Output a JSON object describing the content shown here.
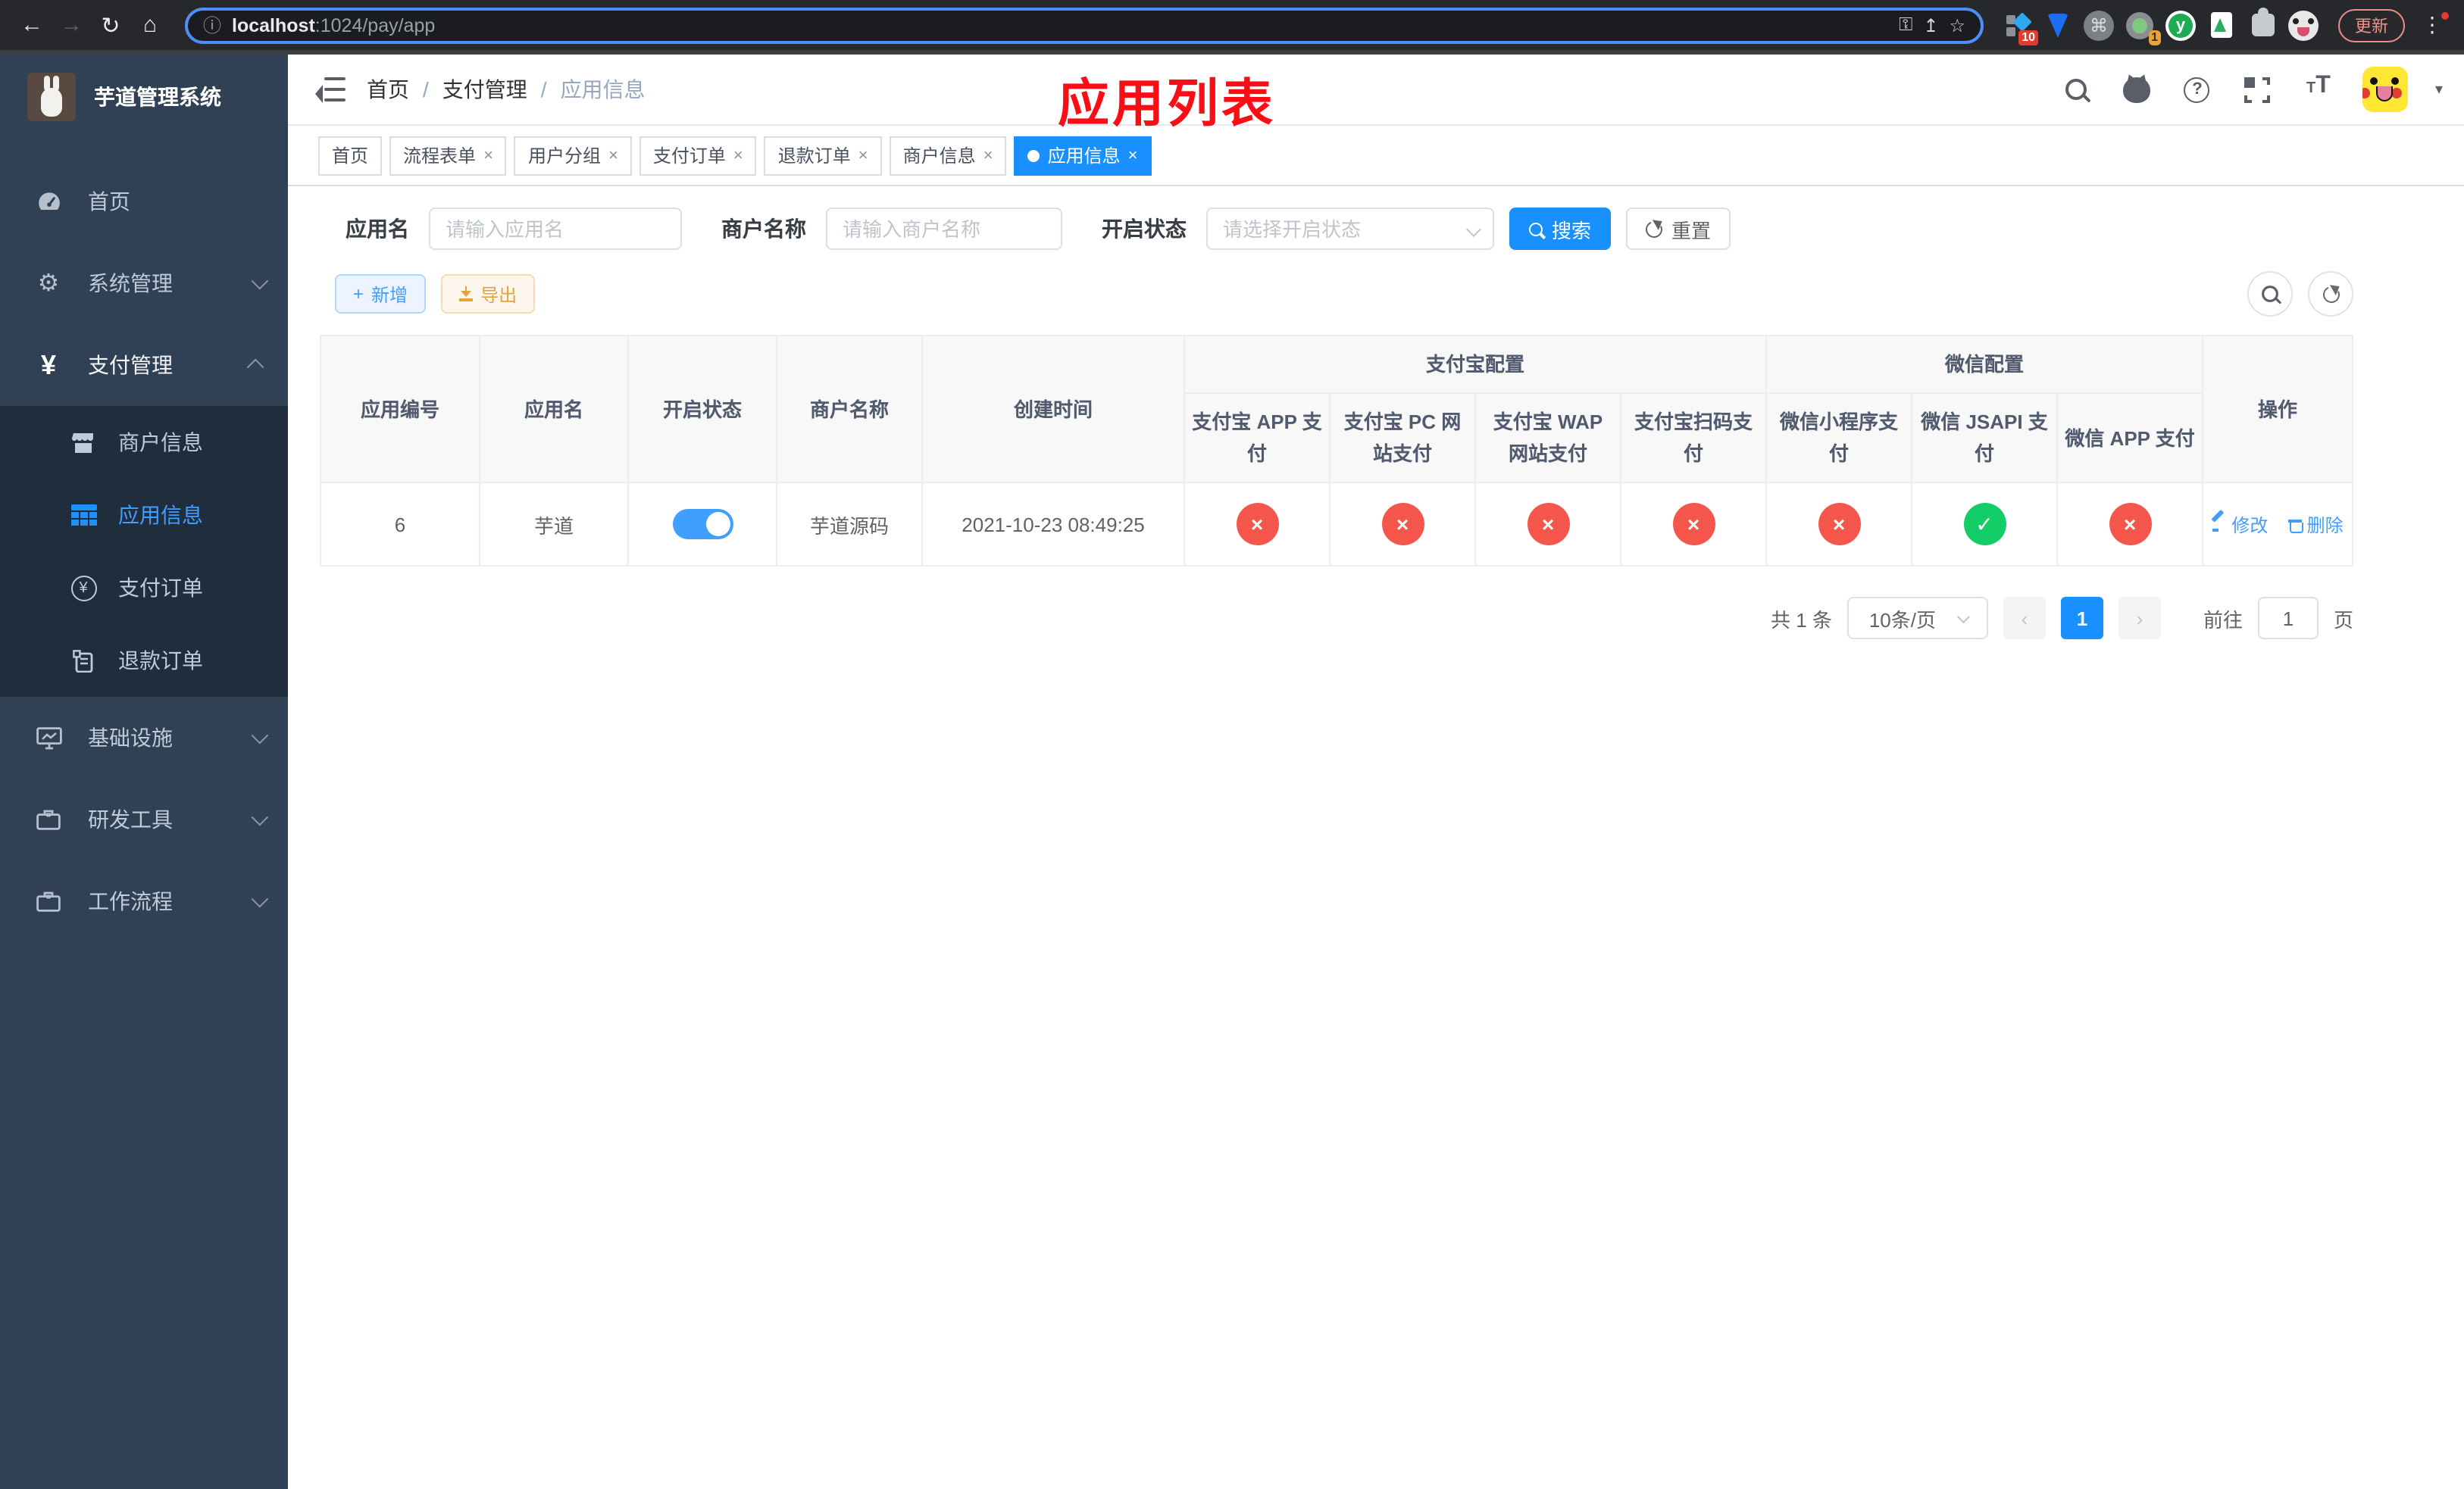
{
  "icons": {
    "back": "←",
    "forward": "→",
    "reload": "↻",
    "home": "⌂",
    "info": "ⓘ",
    "star": "☆",
    "command": "⌘",
    "menu_dots": "⋮",
    "caret_down": "▾",
    "gear": "⚙",
    "yen": "¥",
    "help": "?",
    "plus": "+",
    "close": "×",
    "sep": "/",
    "vue_y": "y",
    "chevron_left": "‹",
    "chevron_right": "›",
    "font_big": "T",
    "font_small": "T",
    "key": "⚿",
    "share": "↥",
    "doc": "≡"
  },
  "browser": {
    "url_host": "localhost",
    "url_path": ":1024/pay/app",
    "ext_badge_count": "10",
    "ext_tag_count": "1",
    "update_label": "更新"
  },
  "sidebar": {
    "title": "芋道管理系统",
    "items": [
      {
        "label": "首页"
      },
      {
        "label": "系统管理"
      },
      {
        "label": "支付管理"
      },
      {
        "label": "基础设施"
      },
      {
        "label": "研发工具"
      },
      {
        "label": "工作流程"
      }
    ],
    "submenu": [
      {
        "label": "商户信息"
      },
      {
        "label": "应用信息"
      },
      {
        "label": "支付订单"
      },
      {
        "label": "退款订单"
      }
    ]
  },
  "header": {
    "breadcrumb": [
      "首页",
      "支付管理",
      "应用信息"
    ],
    "annotation": "应用列表"
  },
  "tabs": [
    {
      "label": "首页"
    },
    {
      "label": "流程表单"
    },
    {
      "label": "用户分组"
    },
    {
      "label": "支付订单"
    },
    {
      "label": "退款订单"
    },
    {
      "label": "商户信息"
    },
    {
      "label": "应用信息"
    }
  ],
  "filters": {
    "app_name_label": "应用名",
    "app_name_placeholder": "请输入应用名",
    "merchant_label": "商户名称",
    "merchant_placeholder": "请输入商户名称",
    "status_label": "开启状态",
    "status_placeholder": "请选择开启状态",
    "search_label": "搜索",
    "reset_label": "重置"
  },
  "toolbar": {
    "add_label": "新增",
    "export_label": "导出"
  },
  "table": {
    "headers": {
      "app_id": "应用编号",
      "app_name": "应用名",
      "status": "开启状态",
      "merchant": "商户名称",
      "created": "创建时间",
      "alipay_group": "支付宝配置",
      "wechat_group": "微信配置",
      "actions": "操作",
      "alipay_app": "支付宝 APP 支付",
      "alipay_pc": "支付宝 PC 网站支付",
      "alipay_wap": "支付宝 WAP 网站支付",
      "alipay_qr": "支付宝扫码支付",
      "wx_mini": "微信小程序支付",
      "wx_jsapi": "微信 JSAPI 支付",
      "wx_app": "微信 APP 支付"
    },
    "row": {
      "app_id": "6",
      "app_name": "芋道",
      "switch_on": "true",
      "merchant": "芋道源码",
      "created": "2021-10-23 08:49:25",
      "statuses": [
        {
          "glyph": "×",
          "state": "fail"
        },
        {
          "glyph": "×",
          "state": "fail"
        },
        {
          "glyph": "×",
          "state": "fail"
        },
        {
          "glyph": "×",
          "state": "fail"
        },
        {
          "glyph": "×",
          "state": "fail"
        },
        {
          "glyph": "✓",
          "state": "success"
        },
        {
          "glyph": "×",
          "state": "fail"
        }
      ],
      "edit_label": "修改",
      "delete_label": "删除"
    }
  },
  "pagination": {
    "total": "共 1 条",
    "page_size": "10条/页",
    "page": "1",
    "goto_label": "前往",
    "goto_value": "1",
    "unit_label": "页"
  },
  "colors": {
    "accent": "#1890ff",
    "link": "#409eff",
    "danger": "#f5564c",
    "success": "#13ce66",
    "warning": "#e6a23c",
    "sidebar_bg": "#304156",
    "submenu_bg": "#1f2d3d"
  }
}
